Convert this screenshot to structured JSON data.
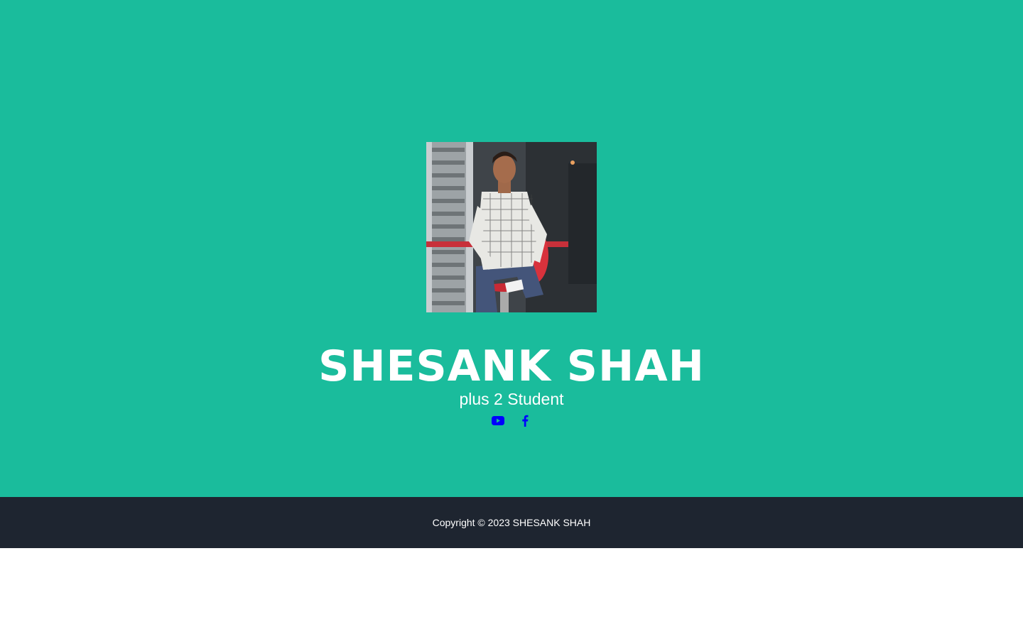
{
  "profile": {
    "photo_alt": "profile photo",
    "name": "SHESANK SHAH",
    "subtitle": "plus 2 Student"
  },
  "social": [
    {
      "name": "youtube",
      "icon": "youtube-icon"
    },
    {
      "name": "facebook",
      "icon": "facebook-icon"
    }
  ],
  "footer": {
    "copyright": "Copyright © 2023 SHESANK SHAH"
  },
  "colors": {
    "hero_bg": "#1abc9c",
    "footer_bg": "#1e2530",
    "icon": "#0000ff",
    "text": "#ffffff"
  }
}
